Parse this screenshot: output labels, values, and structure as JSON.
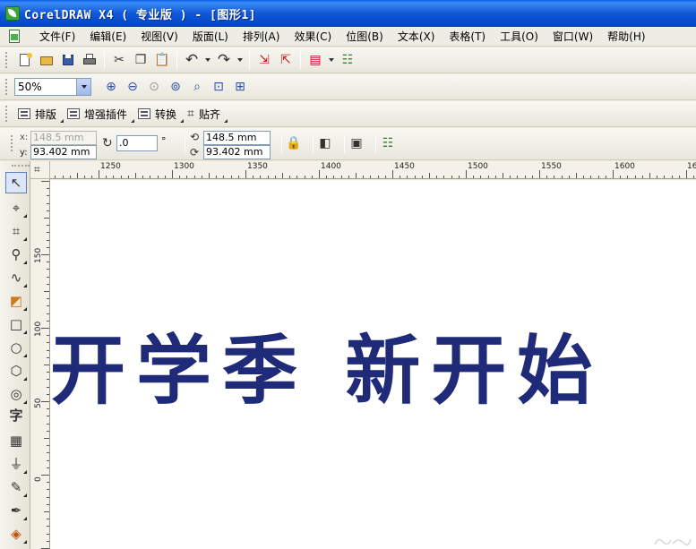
{
  "titlebar": {
    "title": "CorelDRAW X4 ( 专业版 ) - [图形1]"
  },
  "menubar": {
    "items": [
      {
        "label": "文件(F)"
      },
      {
        "label": "编辑(E)"
      },
      {
        "label": "视图(V)"
      },
      {
        "label": "版面(L)"
      },
      {
        "label": "排列(A)"
      },
      {
        "label": "效果(C)"
      },
      {
        "label": "位图(B)"
      },
      {
        "label": "文本(X)"
      },
      {
        "label": "表格(T)"
      },
      {
        "label": "工具(O)"
      },
      {
        "label": "窗口(W)"
      },
      {
        "label": "帮助(H)"
      }
    ]
  },
  "zoom": {
    "value": "50%"
  },
  "plugins": {
    "items": [
      {
        "label": "排版"
      },
      {
        "label": "增强插件"
      },
      {
        "label": "转换"
      },
      {
        "label": "贴齐"
      }
    ]
  },
  "propbar": {
    "x_label": "x:",
    "x_value": "148.5 mm",
    "y_label": "y:",
    "y_value": "93.402 mm",
    "rotation_value": ".0",
    "degree_symbol": "°",
    "cx_value": "148.5 mm",
    "cy_value": "93.402 mm"
  },
  "ruler_h": {
    "labels": [
      "1250",
      "1300",
      "1350",
      "1400",
      "1450",
      "1500",
      "1550",
      "1600",
      "16"
    ]
  },
  "ruler_v": {
    "labels": [
      "150",
      "100",
      "50",
      "0"
    ]
  },
  "canvas": {
    "headline": "开学季 新开始"
  },
  "colors": {
    "headline": "#1F2A78",
    "titlebar": "#0A5EE8",
    "chrome": "#ECE9D8"
  }
}
